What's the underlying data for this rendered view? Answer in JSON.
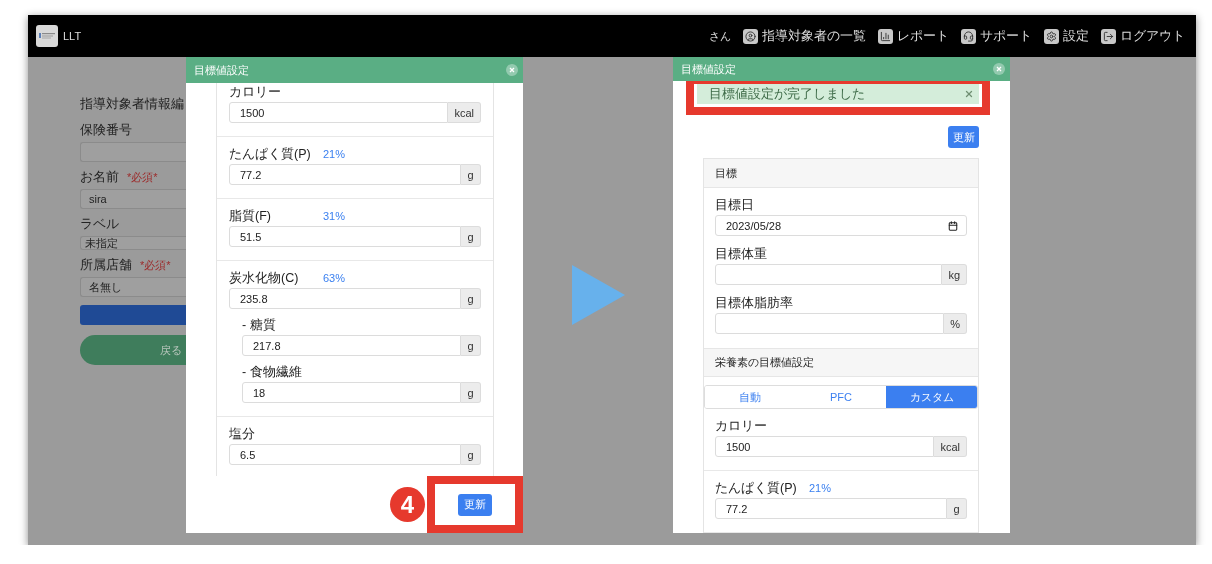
{
  "header": {
    "brand": "LLT",
    "user": "さん",
    "nav": [
      {
        "label": "指導対象者の一覧"
      },
      {
        "label": "レポート"
      },
      {
        "label": "サポート"
      },
      {
        "label": "設定"
      },
      {
        "label": "ログアウト"
      }
    ]
  },
  "form": {
    "title": "指導対象者情報編",
    "fields": [
      {
        "label": "保険番号",
        "kind": "input"
      },
      {
        "label": "お名前",
        "required": "*必須*",
        "kind": "input",
        "value": "sira"
      },
      {
        "label": "ラベル",
        "kind": "select",
        "value": "未指定"
      },
      {
        "label": "所属店舗",
        "required": "*必須*",
        "kind": "input",
        "value": "名無し"
      }
    ],
    "buttons": [
      {
        "kind": "primary"
      },
      {
        "kind": "back",
        "label": "戻る"
      }
    ]
  },
  "modal_before": {
    "title": "目標値設定",
    "sections": [
      {
        "fields": [
          {
            "kind": "main",
            "label": "カロリー",
            "value": "1500",
            "unit": "kcal"
          }
        ]
      },
      {
        "fields": [
          {
            "kind": "main",
            "label": "たんぱく質(P)",
            "ratio": "21%",
            "value": "77.2",
            "unit": "g"
          }
        ]
      },
      {
        "fields": [
          {
            "kind": "main",
            "label": "脂質(F)",
            "ratio": "31%",
            "value": "51.5",
            "unit": "g"
          }
        ]
      },
      {
        "fields": [
          {
            "kind": "main",
            "label": "炭水化物(C)",
            "ratio": "63%",
            "value": "235.8",
            "unit": "g"
          },
          {
            "kind": "sub",
            "label": "- 糖質",
            "value": "217.8",
            "unit": "g"
          },
          {
            "kind": "sub",
            "label": "- 食物繊維",
            "value": "18",
            "unit": "g"
          }
        ]
      },
      {
        "fields": [
          {
            "kind": "main",
            "label": "塩分",
            "value": "6.5",
            "unit": "g"
          }
        ]
      }
    ],
    "step": "4",
    "submit": "更新"
  },
  "modal_after": {
    "title": "目標値設定",
    "alert": "目標値設定が完了しました",
    "submit": "更新",
    "goal_section": {
      "title": "目標",
      "fields": [
        {
          "kind": "date",
          "label": "目標日",
          "value": "2023/05/28"
        },
        {
          "kind": "unit",
          "label": "目標体重",
          "unit": "kg"
        },
        {
          "kind": "unit",
          "label": "目標体脂肪率",
          "unit": "%"
        }
      ]
    },
    "nutrient_section": {
      "title": "栄養素の目標値設定",
      "tabs": [
        {
          "label": "自動",
          "selected": false
        },
        {
          "label": "PFC",
          "selected": false
        },
        {
          "label": "カスタム",
          "selected": true
        }
      ],
      "sections": [
        {
          "fields": [
            {
              "kind": "main",
              "label": "カロリー",
              "value": "1500",
              "unit": "kcal"
            }
          ]
        },
        {
          "fields": [
            {
              "kind": "main",
              "label": "たんぱく質(P)",
              "ratio": "21%",
              "value": "77.2",
              "unit": "g"
            }
          ]
        }
      ]
    }
  }
}
